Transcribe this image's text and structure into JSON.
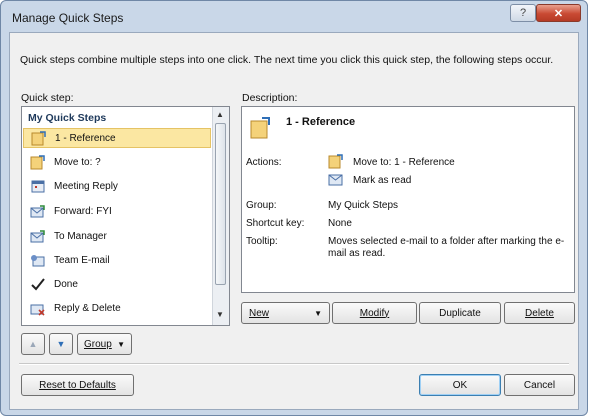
{
  "window": {
    "title": "Manage Quick Steps",
    "help_glyph": "?",
    "close_glyph": "✕"
  },
  "intro_text": "Quick steps combine multiple steps into one click. The next time you click this quick step, the following steps occur.",
  "quick_step_label": "Quick step:",
  "description_label": "Description:",
  "list": {
    "header": "My Quick Steps",
    "items": [
      {
        "label": "1 - Reference",
        "icon": "folder-move-icon",
        "selected": true
      },
      {
        "label": "Move to: ?",
        "icon": "folder-move-icon"
      },
      {
        "label": "Meeting Reply",
        "icon": "calendar-icon"
      },
      {
        "label": "Forward: FYI",
        "icon": "forward-mail-icon"
      },
      {
        "label": "To Manager",
        "icon": "forward-mail-icon"
      },
      {
        "label": "Team E-mail",
        "icon": "team-mail-icon"
      },
      {
        "label": "Done",
        "icon": "checkmark-icon"
      },
      {
        "label": "Reply & Delete",
        "icon": "reply-delete-icon"
      }
    ]
  },
  "description": {
    "title": "1 - Reference",
    "actions_label": "Actions:",
    "actions": [
      "Move to: 1 - Reference",
      "Mark as read"
    ],
    "group_label": "Group:",
    "group_value": "My Quick Steps",
    "shortcut_label": "Shortcut key:",
    "shortcut_value": "None",
    "tooltip_label": "Tooltip:",
    "tooltip_value": "Moves selected e-mail to a folder after marking the e-mail as read."
  },
  "buttons": {
    "new": "New",
    "modify": "Modify",
    "duplicate": "Duplicate",
    "delete": "Delete",
    "group": "Group",
    "reset": "Reset to Defaults",
    "ok": "OK",
    "cancel": "Cancel"
  }
}
